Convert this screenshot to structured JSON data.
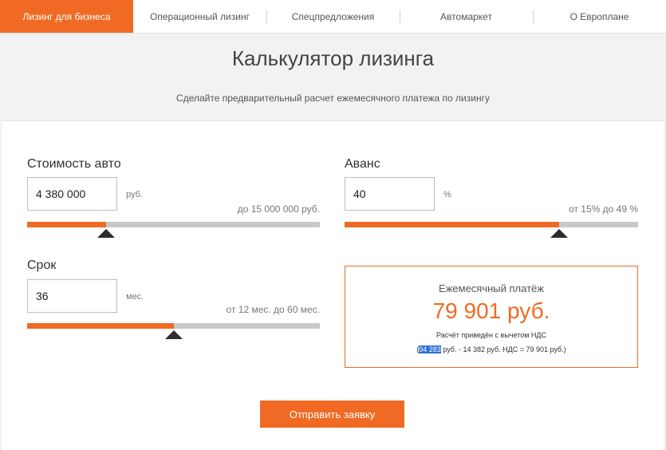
{
  "nav": {
    "items": [
      {
        "label": "Лизинг для бизнеса",
        "active": true
      },
      {
        "label": "Операционный лизинг",
        "active": false
      },
      {
        "label": "Спецпредложения",
        "active": false
      },
      {
        "label": "Автомаркет",
        "active": false
      },
      {
        "label": "О Европлане",
        "active": false
      }
    ]
  },
  "page": {
    "title": "Калькулятор лизинга",
    "subtitle": "Сделайте предварительный расчет ежемесячного платежа по лизингу"
  },
  "calculator": {
    "price": {
      "label": "Стоимость авто",
      "value": "4 380 000",
      "unit": "руб.",
      "range": "до 15 000 000 руб.",
      "slider_percent": 27
    },
    "advance": {
      "label": "Аванс",
      "value": "40",
      "unit": "%",
      "range": "от 15% до 49 %",
      "slider_percent": 73
    },
    "term": {
      "label": "Срок",
      "value": "36",
      "unit": "мес.",
      "range": "от 12 мес. до 60 мес.",
      "slider_percent": 50
    }
  },
  "result": {
    "label": "Ежемесячный платёж",
    "value": "79 901 руб.",
    "note": "Расчёт приведён с вычетом НДС",
    "formula_open": "(",
    "formula_highlight": "94 283",
    "formula_rest": " руб. - 14 382 руб. НДС = 79 901 руб.)"
  },
  "submit_label": "Отправить заявку",
  "colors": {
    "accent": "#f06a23",
    "track": "#c8c8c8",
    "thumb": "#2d2d2d",
    "selection": "#2a6fd6"
  }
}
